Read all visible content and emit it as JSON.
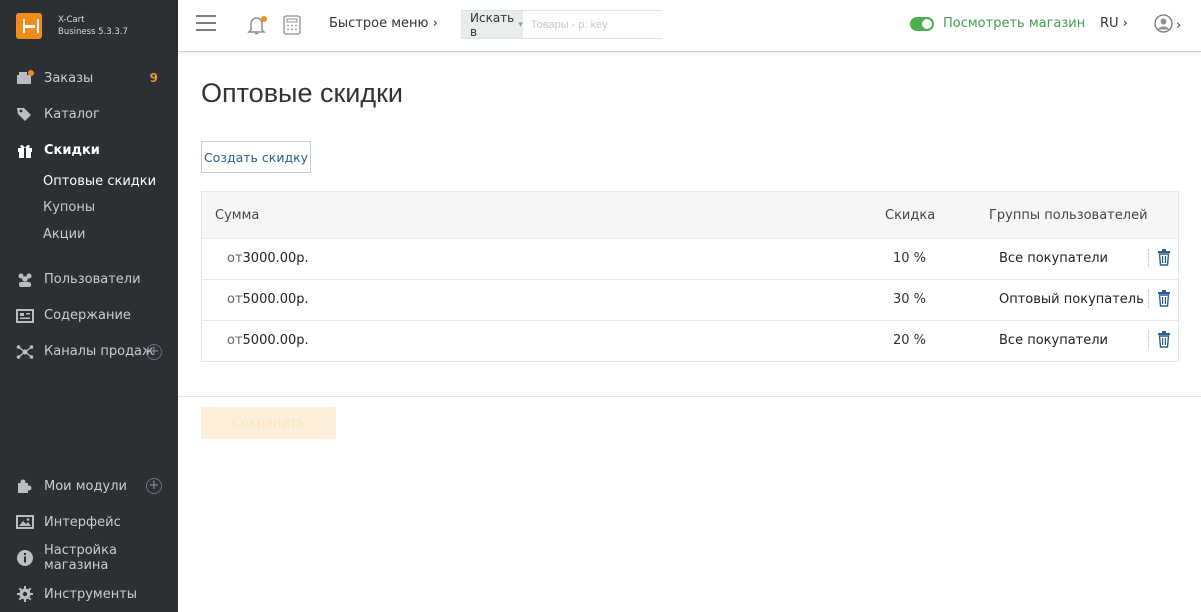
{
  "brand": {
    "name": "X-Cart",
    "edition": "Business 5.3.3.7"
  },
  "sidebar": {
    "items": [
      {
        "label": "Заказы",
        "count": "9"
      },
      {
        "label": "Каталог"
      },
      {
        "label": "Скидки"
      },
      {
        "label": "Пользователи"
      },
      {
        "label": "Содержание"
      },
      {
        "label": "Каналы продаж"
      }
    ],
    "subitems": [
      {
        "label": "Оптовые скидки"
      },
      {
        "label": "Купоны"
      },
      {
        "label": "Акции"
      }
    ],
    "bottom": [
      {
        "label": "Мои модули"
      },
      {
        "label": "Интерфейс"
      },
      {
        "label": "Настройка магазина"
      },
      {
        "label": "Инструменты"
      }
    ]
  },
  "header": {
    "quick_menu": "Быстрое меню ›",
    "search": {
      "select_label": "Искать в",
      "placeholder": "Товары - p: key"
    },
    "view_store": "Посмотреть магазин",
    "lang": "RU ›",
    "user_chevron": "›"
  },
  "main": {
    "title": "Оптовые скидки",
    "create_button": "Создать скидку",
    "table": {
      "headers": {
        "sum": "Сумма",
        "discount": "Скидка",
        "groups": "Группы пользователей"
      },
      "rows": [
        {
          "prefix": "от",
          "amount": "3000.00р.",
          "discount": "10 %",
          "group": "Все покупатели"
        },
        {
          "prefix": "от",
          "amount": "5000.00р.",
          "discount": "30 %",
          "group": "Оптовый покупатель"
        },
        {
          "prefix": "от",
          "amount": "5000.00р.",
          "discount": "20 %",
          "group": "Все покупатели"
        }
      ]
    },
    "save_button": "Сохранить"
  }
}
